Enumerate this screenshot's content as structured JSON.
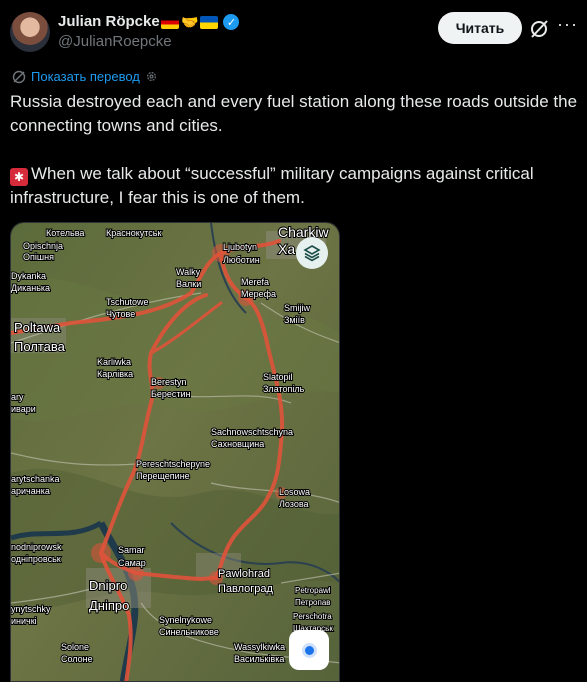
{
  "author": {
    "name": "Julian Röpcke",
    "handle": "@JulianRoepcke",
    "flags": [
      "de-flag-icon",
      "handshake-icon",
      "ua-flag-icon"
    ],
    "verified": true
  },
  "actions": {
    "follow_label": "Читать"
  },
  "translate": {
    "label": "Показать перевод"
  },
  "post": {
    "paragraph1": "Russia destroyed each and every fuel station along these roads outside the connecting towns and cities.",
    "siren_icon": "rotating-light-icon",
    "paragraph2": "When we talk about “successful” military campaigns against critical infrastructure, I fear this is one of them."
  },
  "colors": {
    "accent": "#1d9bf0",
    "background": "#000000",
    "text": "#e7e9ea",
    "muted": "#71767b",
    "route": "#e0533a"
  },
  "map": {
    "labels": [
      "Котельва",
      "Opischnja",
      "Опішня",
      "Краснокутськ",
      "Charkiw",
      "Ха",
      "Ljubotyn",
      "Люботин",
      "Dykanka",
      "Диканька",
      "Walky",
      "Валки",
      "Merefa",
      "Мерефа",
      "Tschutowe",
      "Чутове",
      "Smijiw",
      "Зміїв",
      "Poltawa",
      "Полтава",
      "Karliwka",
      "Карлівка",
      "Berestyn",
      "Берестин",
      "Slatopil",
      "Златопіль",
      "ary",
      "ивари",
      "Sachnowschtschyna",
      "Сахновщина",
      "Pereschtschepyne",
      "Перещепине",
      "arytschanka",
      "аричанка",
      "Losowa",
      "Лозова",
      "nodniprowsk",
      "одніпровськ",
      "Samar",
      "Самар",
      "Pawlohrad",
      "Павлоград",
      "Dnipro",
      "Дніпро",
      "Petropawl",
      "Петропав",
      "Perschotra",
      "Шахтарськ",
      "ynytschky",
      "иничкі",
      "Synelnykowe",
      "Синельникове",
      "Solone",
      "Солоне",
      "Wassylkiwka",
      "Васильківка"
    ]
  }
}
